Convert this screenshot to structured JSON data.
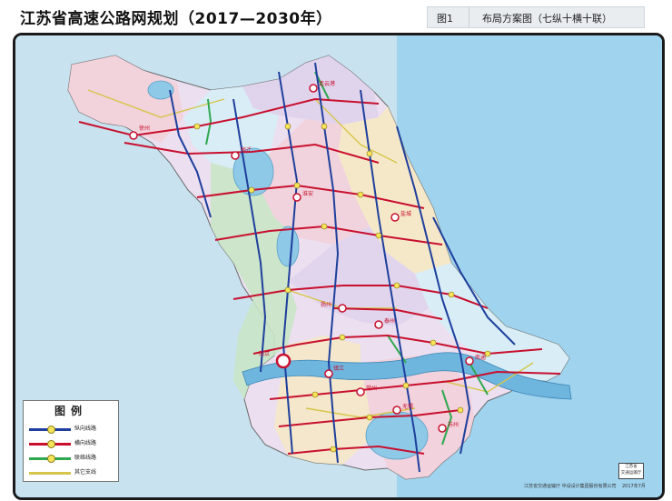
{
  "header": {
    "title": "江苏省高速公路网规划（2017—2030年）",
    "figure_no": "图1",
    "figure_caption": "布局方案图（七纵十横十联）"
  },
  "legend": {
    "title": "图例",
    "items": [
      {
        "label": "纵向线路",
        "color": "#1e3f9c",
        "node": true
      },
      {
        "label": "横向线路",
        "color": "#c8102e",
        "node": true
      },
      {
        "label": "联络线路",
        "color": "#2fa84f",
        "node": true
      },
      {
        "label": "其它支线",
        "color": "#d6c54a",
        "node": false
      }
    ]
  },
  "map": {
    "sea_color": "#8fc9e8",
    "province_colors": [
      "#f3d0d8",
      "#c9e6c6",
      "#dfd3ec",
      "#f6e9c4",
      "#d6eef6"
    ],
    "city_labels": [
      "连云港",
      "徐州",
      "宿迁",
      "淮安",
      "盐城",
      "扬州",
      "泰州",
      "南通",
      "南京",
      "镇江",
      "常州",
      "无锡",
      "苏州"
    ]
  },
  "footer": {
    "credit_left": "江苏省交通运输厅   中设设计集团股份有限公司",
    "credit_right": "2017年7月",
    "stamp_line1": "江苏省",
    "stamp_line2": "交通运输厅"
  }
}
